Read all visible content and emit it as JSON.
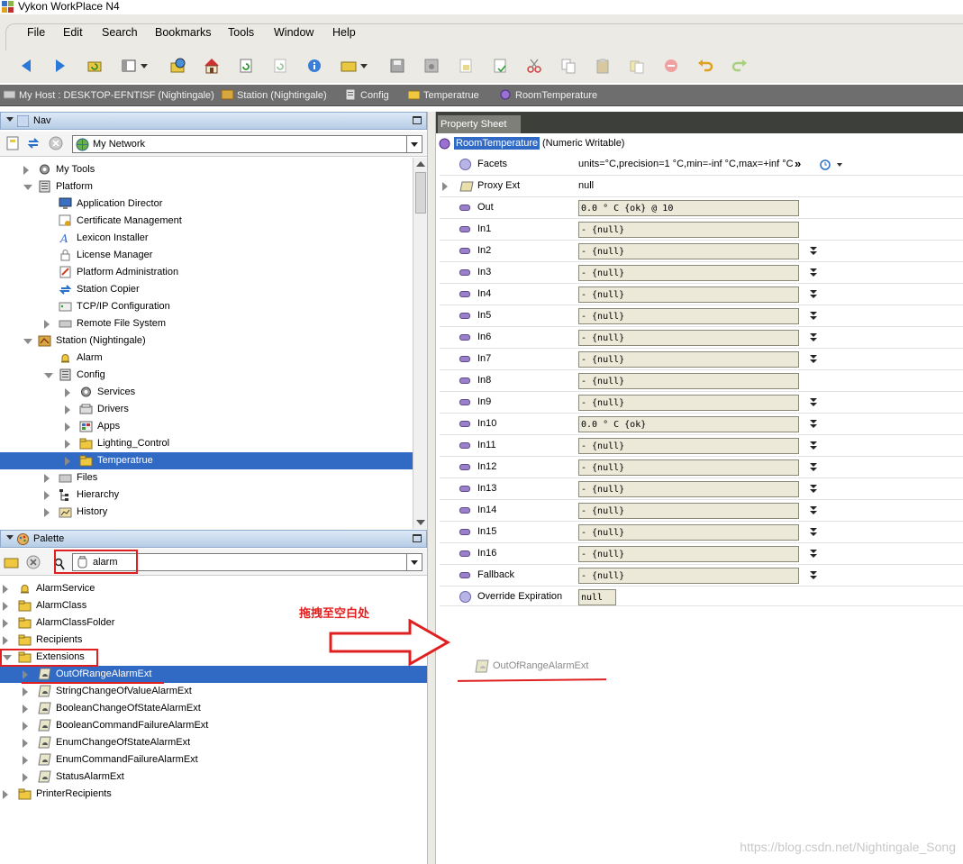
{
  "window": {
    "title": "Vykon WorkPlace N4"
  },
  "menu": [
    "File",
    "Edit",
    "Search",
    "Bookmarks",
    "Tools",
    "Window",
    "Help"
  ],
  "toolbar_icons": [
    "back-arrow-icon",
    "forward-arrow-icon",
    "refresh-folder-icon",
    "sidebar-icon",
    "dropdown-icon",
    "history-icon",
    "home-icon",
    "refresh-icon",
    "sync-icon",
    "info-icon",
    "open-folder-icon",
    "save-icon",
    "save-all-icon",
    "copy-doc-icon",
    "export-icon",
    "cut-icon",
    "copy-icon",
    "paste-icon",
    "duplicate-icon",
    "delete-icon",
    "undo-icon",
    "redo-icon"
  ],
  "breadcrumb": [
    "My Host : DESKTOP-EFNTISF (Nightingale)",
    "Station (Nightingale)",
    "Config",
    "Temperatrue",
    "RoomTemperature"
  ],
  "nav": {
    "title": "Nav",
    "network_value": "My Network",
    "tree": [
      {
        "label": "My Tools",
        "indent": 0,
        "exp": "closed"
      },
      {
        "label": "Platform",
        "indent": 0,
        "exp": "open"
      },
      {
        "label": "Application Director",
        "indent": 1,
        "exp": "none"
      },
      {
        "label": "Certificate Management",
        "indent": 1,
        "exp": "none"
      },
      {
        "label": "Lexicon Installer",
        "indent": 1,
        "exp": "none"
      },
      {
        "label": "License Manager",
        "indent": 1,
        "exp": "none"
      },
      {
        "label": "Platform Administration",
        "indent": 1,
        "exp": "none"
      },
      {
        "label": "Station Copier",
        "indent": 1,
        "exp": "none"
      },
      {
        "label": "TCP/IP Configuration",
        "indent": 1,
        "exp": "none"
      },
      {
        "label": "Remote File System",
        "indent": 1,
        "exp": "closed"
      },
      {
        "label": "Station (Nightingale)",
        "indent": 0,
        "exp": "open"
      },
      {
        "label": "Alarm",
        "indent": 1,
        "exp": "none"
      },
      {
        "label": "Config",
        "indent": 1,
        "exp": "open"
      },
      {
        "label": "Services",
        "indent": 2,
        "exp": "closed"
      },
      {
        "label": "Drivers",
        "indent": 2,
        "exp": "closed"
      },
      {
        "label": "Apps",
        "indent": 2,
        "exp": "closed"
      },
      {
        "label": "Lighting_Control",
        "indent": 2,
        "exp": "closed"
      },
      {
        "label": "Temperatrue",
        "indent": 2,
        "exp": "closed",
        "selected": true
      },
      {
        "label": "Files",
        "indent": 1,
        "exp": "closed"
      },
      {
        "label": "Hierarchy",
        "indent": 1,
        "exp": "closed"
      },
      {
        "label": "History",
        "indent": 1,
        "exp": "closed"
      }
    ]
  },
  "palette": {
    "title": "Palette",
    "search_value": "alarm",
    "tree": [
      {
        "label": "AlarmService",
        "indent": 0,
        "exp": "closed"
      },
      {
        "label": "AlarmClass",
        "indent": 0,
        "exp": "closed"
      },
      {
        "label": "AlarmClassFolder",
        "indent": 0,
        "exp": "closed"
      },
      {
        "label": "Recipients",
        "indent": 0,
        "exp": "closed"
      },
      {
        "label": "Extensions",
        "indent": 0,
        "exp": "open"
      },
      {
        "label": "OutOfRangeAlarmExt",
        "indent": 1,
        "exp": "closed",
        "selected": true
      },
      {
        "label": "StringChangeOfValueAlarmExt",
        "indent": 1,
        "exp": "closed"
      },
      {
        "label": "BooleanChangeOfStateAlarmExt",
        "indent": 1,
        "exp": "closed"
      },
      {
        "label": "BooleanCommandFailureAlarmExt",
        "indent": 1,
        "exp": "closed"
      },
      {
        "label": "EnumChangeOfStateAlarmExt",
        "indent": 1,
        "exp": "closed"
      },
      {
        "label": "EnumCommandFailureAlarmExt",
        "indent": 1,
        "exp": "closed"
      },
      {
        "label": "StatusAlarmExt",
        "indent": 1,
        "exp": "closed"
      },
      {
        "label": "PrinterRecipients",
        "indent": 0,
        "exp": "closed"
      }
    ]
  },
  "property_sheet": {
    "tab": "Property Sheet",
    "component": "RoomTemperature",
    "component_type": "(Numeric Writable)",
    "rows": [
      {
        "name": "Facets",
        "kind": "text",
        "value": "units=°C,precision=1 °C,min=-inf °C,max=+inf °C",
        "icon": "circle"
      },
      {
        "name": "Proxy Ext",
        "kind": "text",
        "value": "null",
        "icon": "folder",
        "expandable": true
      },
      {
        "name": "Out",
        "kind": "box",
        "value": "0.0 ° C {ok} @ 10",
        "action": false
      },
      {
        "name": "In1",
        "kind": "box",
        "value": "- {null}",
        "action": false
      },
      {
        "name": "In2",
        "kind": "box",
        "value": "- {null}",
        "action": true
      },
      {
        "name": "In3",
        "kind": "box",
        "value": "- {null}",
        "action": true
      },
      {
        "name": "In4",
        "kind": "box",
        "value": "- {null}",
        "action": true
      },
      {
        "name": "In5",
        "kind": "box",
        "value": "- {null}",
        "action": true
      },
      {
        "name": "In6",
        "kind": "box",
        "value": "- {null}",
        "action": true
      },
      {
        "name": "In7",
        "kind": "box",
        "value": "- {null}",
        "action": true
      },
      {
        "name": "In8",
        "kind": "box",
        "value": "- {null}",
        "action": false
      },
      {
        "name": "In9",
        "kind": "box",
        "value": "- {null}",
        "action": true
      },
      {
        "name": "In10",
        "kind": "box",
        "value": "0.0 ° C {ok}",
        "action": true
      },
      {
        "name": "In11",
        "kind": "box",
        "value": "- {null}",
        "action": true
      },
      {
        "name": "In12",
        "kind": "box",
        "value": "- {null}",
        "action": true
      },
      {
        "name": "In13",
        "kind": "box",
        "value": "- {null}",
        "action": true
      },
      {
        "name": "In14",
        "kind": "box",
        "value": "- {null}",
        "action": true
      },
      {
        "name": "In15",
        "kind": "box",
        "value": "- {null}",
        "action": true
      },
      {
        "name": "In16",
        "kind": "box",
        "value": "- {null}",
        "action": true
      },
      {
        "name": "Fallback",
        "kind": "box",
        "value": "- {null}",
        "action": true
      },
      {
        "name": "Override Expiration",
        "kind": "smallbox",
        "value": "null",
        "action": false,
        "icon": "circle"
      }
    ]
  },
  "annotation": {
    "drag_note": "拖拽至空白处",
    "dropped_item": "OutOfRangeAlarmExt",
    "color": "#e02020"
  },
  "watermark": "https://blog.csdn.net/Nightingale_Song"
}
